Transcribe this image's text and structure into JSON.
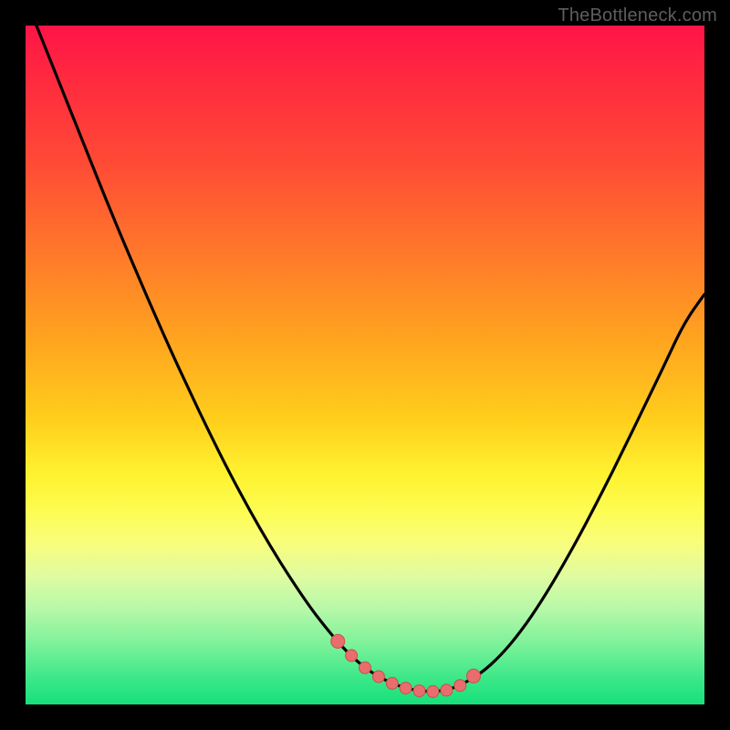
{
  "attribution": "TheBottleneck.com",
  "colors": {
    "frame": "#000000",
    "curve": "#000000",
    "markers_fill": "#ea6d6d",
    "markers_stroke": "#c94f4f",
    "gradient_top": "#ff1447",
    "gradient_bottom": "#16e07a"
  },
  "chart_data": {
    "type": "line",
    "title": "",
    "xlabel": "",
    "ylabel": "",
    "xlim": [
      0,
      100
    ],
    "ylim": [
      0,
      100
    ],
    "x": [
      0,
      3,
      6,
      9,
      12,
      15,
      18,
      21,
      24,
      27,
      30,
      33,
      36,
      39,
      42,
      44,
      46,
      48,
      50,
      52,
      54,
      56,
      58,
      60,
      62,
      64,
      67,
      70,
      73,
      76,
      79,
      82,
      85,
      88,
      91,
      94,
      97,
      100
    ],
    "values": [
      104,
      96.5,
      89,
      81.5,
      74,
      66.8,
      59.8,
      53,
      46.5,
      40.2,
      34.2,
      28.6,
      23.4,
      18.6,
      14.2,
      11.6,
      9.2,
      7.1,
      5.4,
      4.1,
      3.1,
      2.4,
      2,
      1.9,
      2.1,
      2.8,
      4.5,
      7.2,
      10.8,
      15.2,
      20.2,
      25.6,
      31.4,
      37.4,
      43.6,
      49.8,
      56.2,
      60.4
    ],
    "markers": {
      "x": [
        46,
        48,
        50,
        52,
        54,
        56,
        58,
        60,
        62,
        64,
        66
      ],
      "y": [
        9.3,
        7.2,
        5.4,
        4.1,
        3.1,
        2.4,
        2,
        1.9,
        2.1,
        2.8,
        4.2
      ]
    },
    "note": "Axes are unlabeled in the source image; x and y are normalized 0–100. Curve descends from top-left, bottoms out near x≈60, then rises toward the right. Marker cluster sits near the trough."
  }
}
